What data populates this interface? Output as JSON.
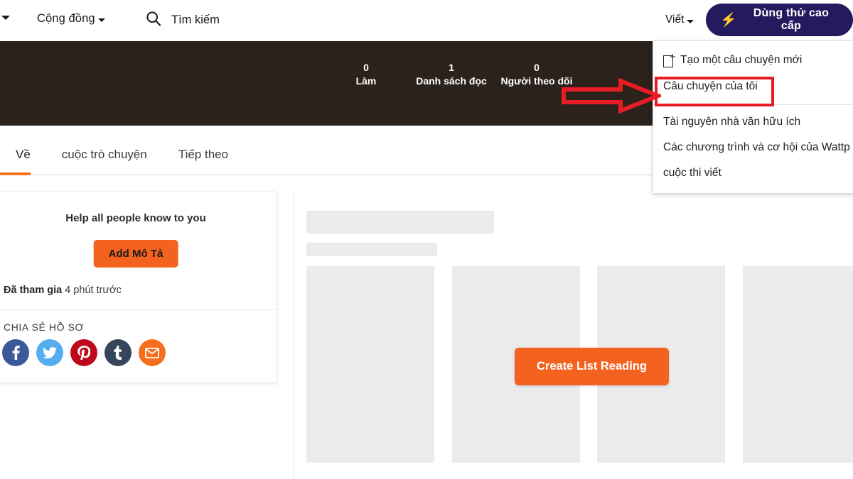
{
  "header": {
    "left_caret_icon": "chevron-down-icon",
    "community_label": "Cộng đồng",
    "search_icon": "search-icon",
    "search_label": "Tìm kiếm",
    "write_label": "Viết",
    "premium_label": "Dùng thử cao cấp",
    "premium_icon": "lightning-bolt-icon",
    "premium_bg": "#241A5E",
    "premium_icon_color": "#FF2D6F"
  },
  "banner": {
    "background": "#2B221C",
    "stats": [
      {
        "value": "0",
        "label": "Làm"
      },
      {
        "value": "1",
        "label": "Danh sách đọc"
      },
      {
        "value": "0",
        "label": "Người theo dõi"
      }
    ]
  },
  "tabs": {
    "active_color": "#F47421",
    "items": [
      {
        "label": "Về",
        "active": true
      },
      {
        "label": "cuộc trò chuyện",
        "active": false
      },
      {
        "label": "Tiếp theo",
        "active": false
      }
    ]
  },
  "profile_card": {
    "help_text": "Help all people know to you",
    "add_description_label": "Add Mô Tả",
    "joined_label": "Đã tham gia",
    "joined_value": "4 phút trước",
    "share_title": "CHIA SẺ HỒ SƠ",
    "share_buttons": [
      {
        "name": "facebook",
        "glyph": "f",
        "color": "#3B5998"
      },
      {
        "name": "twitter",
        "glyph": "t",
        "color": "#55ACEE"
      },
      {
        "name": "pinterest",
        "glyph": "P",
        "color": "#BD081C"
      },
      {
        "name": "tumblr",
        "glyph": "t",
        "color": "#35465C"
      },
      {
        "name": "email",
        "glyph": "m",
        "color": "#F4701F"
      }
    ]
  },
  "reading_list": {
    "create_button_label": "Create List Reading",
    "skeleton_card_count": 4,
    "skeleton_color": "#ebebeb"
  },
  "write_dropdown": {
    "items": [
      {
        "label": "Tạo một câu chuyện mới",
        "icon": "new-document-icon",
        "highlighted": false
      },
      {
        "label": "Câu chuyện của tôi",
        "icon": "",
        "highlighted": true
      },
      {
        "label": "Tài nguyên nhà văn hữu ích",
        "icon": "",
        "highlighted": false
      },
      {
        "label": "Các chương trình và cơ hội của Wattp",
        "icon": "",
        "highlighted": false
      },
      {
        "label": "cuộc thi viết",
        "icon": "",
        "highlighted": false
      }
    ]
  },
  "annotations": {
    "color": "#E81C24",
    "arrow_icon": "right-arrow-icon",
    "highlight_target": "Câu chuyện của tôi"
  }
}
